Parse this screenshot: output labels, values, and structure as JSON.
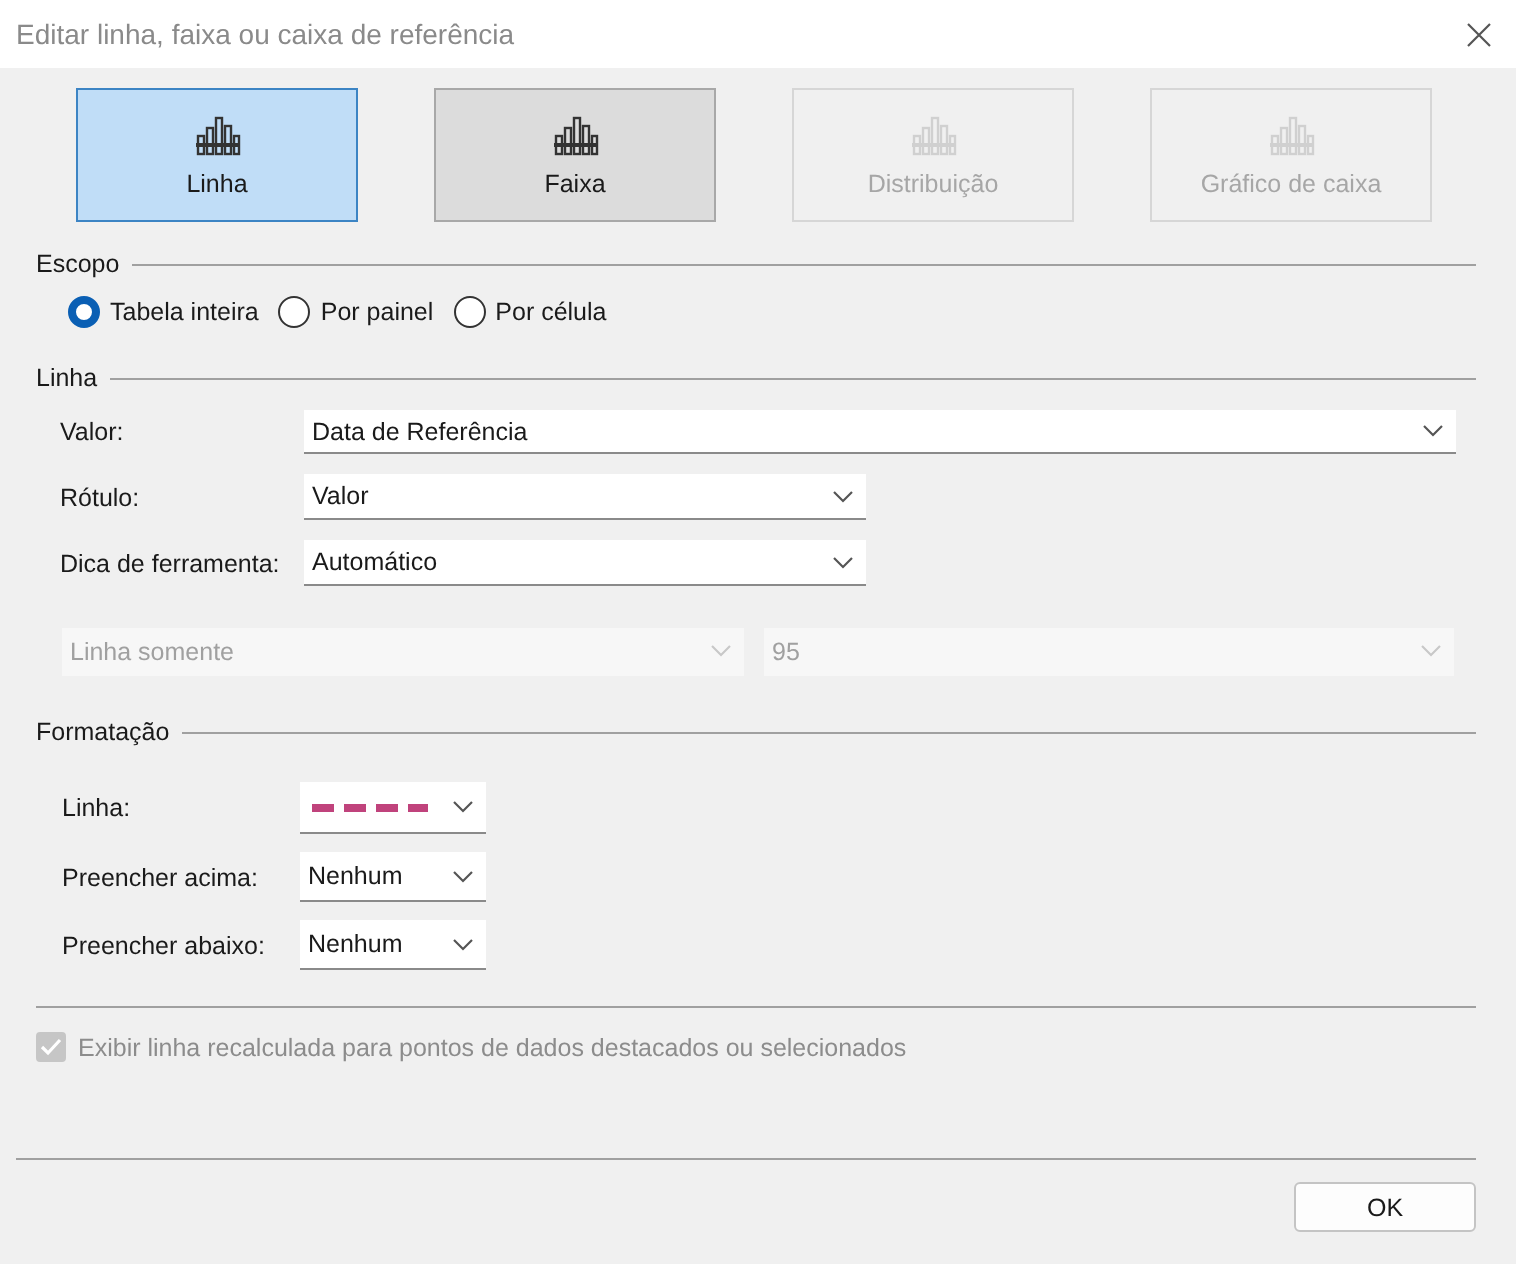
{
  "window": {
    "title": "Editar linha, faixa ou caixa de referência"
  },
  "types": [
    {
      "label": "Linha",
      "selected": true,
      "highlighted": false,
      "disabled": false
    },
    {
      "label": "Faixa",
      "selected": false,
      "highlighted": true,
      "disabled": false
    },
    {
      "label": "Distribuição",
      "selected": false,
      "highlighted": false,
      "disabled": true
    },
    {
      "label": "Gráfico de caixa",
      "selected": false,
      "highlighted": false,
      "disabled": true
    }
  ],
  "scope": {
    "title": "Escopo",
    "options": [
      {
        "label": "Tabela inteira",
        "selected": true
      },
      {
        "label": "Por painel",
        "selected": false
      },
      {
        "label": "Por célula",
        "selected": false
      }
    ]
  },
  "line": {
    "title": "Linha",
    "fields": [
      {
        "label": "Valor:",
        "value": "Data de Referência",
        "kind": "wide"
      },
      {
        "label": "Rótulo:",
        "value": "Valor",
        "kind": "narrow"
      },
      {
        "label": "Dica de ferramenta:",
        "value": "Automático",
        "kind": "narrow"
      }
    ],
    "extra_selects": [
      {
        "value": "Linha somente",
        "disabled": true
      },
      {
        "value": "95",
        "disabled": true
      }
    ]
  },
  "formatting": {
    "title": "Formatação",
    "line": {
      "label": "Linha:",
      "color": "#c0437c"
    },
    "fills": [
      {
        "label": "Preencher acima:",
        "value": "Nenhum"
      },
      {
        "label": "Preencher abaixo:",
        "value": "Nenhum"
      }
    ]
  },
  "recalc": {
    "label": "Exibir linha recalculada para pontos de dados destacados ou selecionados",
    "checked": true,
    "disabled": true
  },
  "buttons": [
    "OK"
  ]
}
